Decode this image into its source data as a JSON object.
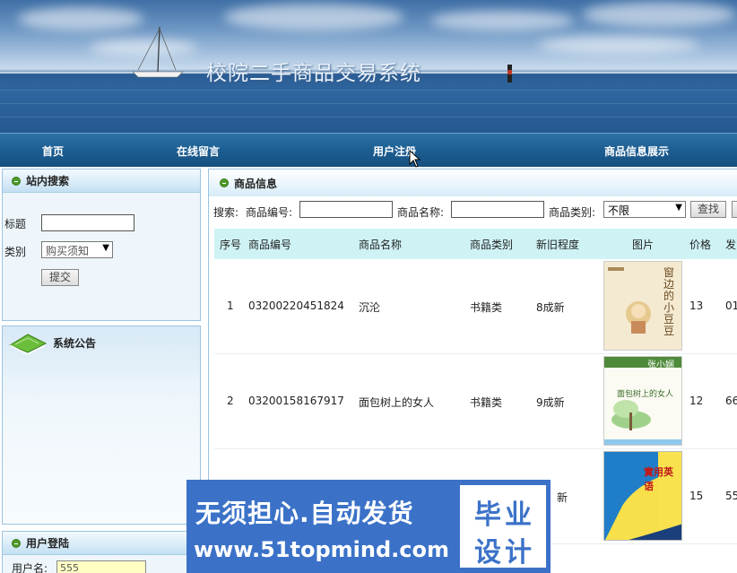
{
  "header": {
    "site_title": "校院二手商品交易系统"
  },
  "nav": {
    "items": [
      "首页",
      "在线留言",
      "用户注册",
      "商品信息展示"
    ]
  },
  "sidebar": {
    "search": {
      "heading": "站内搜索",
      "title_label": "标题",
      "title_value": "",
      "category_label": "类别",
      "category_selected": "购买须知",
      "submit_label": "提交"
    },
    "notice": {
      "heading": "系统公告"
    },
    "login": {
      "heading": "用户登陆",
      "username_label": "用户名:",
      "username_value": "555"
    }
  },
  "main": {
    "heading": "商品信息",
    "search": {
      "label": "搜索:",
      "code_label": "商品编号:",
      "code_value": "",
      "name_label": "商品名称:",
      "name_value": "",
      "category_label": "商品类别:",
      "category_selected": "不限",
      "find_label": "查找"
    },
    "columns": [
      "序号",
      "商品编号",
      "商品名称",
      "商品类别",
      "新旧程度",
      "图片",
      "价格",
      "发"
    ],
    "rows": [
      {
        "index": "1",
        "code": "03200220451824",
        "name": "沉沦",
        "category": "书籍类",
        "condition": "8成新",
        "image": "book-cover-1",
        "price": "13",
        "extra": "01"
      },
      {
        "index": "2",
        "code": "03200158167917",
        "name": "面包树上的女人",
        "category": "书籍类",
        "condition": "9成新",
        "image": "book-cover-2",
        "price": "12",
        "extra": "66"
      },
      {
        "index": "",
        "code": "",
        "name": "",
        "category": "",
        "condition": "新",
        "image": "book-cover-3",
        "price": "15",
        "extra": "55"
      }
    ],
    "cover_texts": {
      "c1": "窗边的小豆豆",
      "c2_author": "张小娴",
      "c2_title": "面包树上的女人",
      "c3": "實用英语"
    }
  },
  "watermark": {
    "line1": "无须担心.自动发货",
    "line2": "www.51topmind.com",
    "badge_top": "毕业",
    "badge_bottom": "设计"
  }
}
